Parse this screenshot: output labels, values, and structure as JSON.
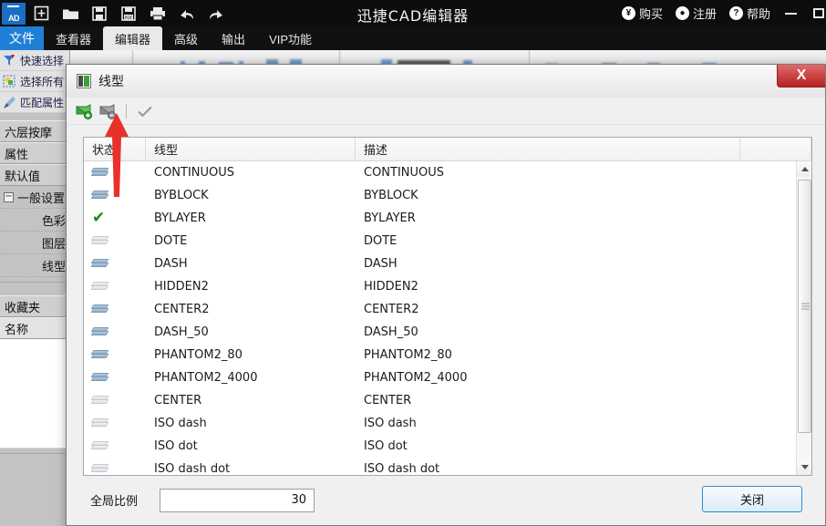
{
  "app": {
    "title": "迅捷CAD编辑器",
    "logo_text": "AD",
    "quick_tools": [
      {
        "name": "new-icon",
        "label": "新建"
      },
      {
        "name": "open-folder-icon",
        "label": "打开"
      },
      {
        "name": "save-icon",
        "label": "保存"
      },
      {
        "name": "save-pdf-icon",
        "label": "另存为PDF"
      },
      {
        "name": "print-icon",
        "label": "打印"
      },
      {
        "name": "undo-icon",
        "label": "撤销"
      },
      {
        "name": "redo-icon",
        "label": "恢复"
      }
    ],
    "right_items": [
      {
        "glyph": "¥",
        "label": "购买",
        "icon": "yen-icon"
      },
      {
        "glyph": "●",
        "label": "注册",
        "icon": "user-icon"
      },
      {
        "glyph": "?",
        "label": "帮助",
        "icon": "question-icon"
      }
    ],
    "window_buttons": [
      {
        "name": "minimize-button",
        "label": "—"
      },
      {
        "name": "maximize-button",
        "label": "□"
      }
    ]
  },
  "menubar": {
    "file_label": "文件",
    "tabs": [
      {
        "label": "查看器",
        "active": false
      },
      {
        "label": "编辑器",
        "active": true
      },
      {
        "label": "高级",
        "active": false
      },
      {
        "label": "输出",
        "active": false
      },
      {
        "label": "VIP功能",
        "active": false
      }
    ]
  },
  "left_panel": {
    "tools": [
      {
        "label": "快速选择",
        "icon": "funnel-icon"
      },
      {
        "label": "选择所有",
        "icon": "select-all-icon"
      },
      {
        "label": "匹配属性",
        "icon": "brush-icon"
      }
    ],
    "doc_tab": "六层按摩",
    "section_properties": "属性",
    "section_defaults": "默认值",
    "group_general": "一般设置",
    "group_items": [
      "色彩",
      "图层",
      "线型"
    ],
    "favorites_header": "收藏夹",
    "favorites_col": "名称"
  },
  "dialog": {
    "title": "线型",
    "close_glyph": "X",
    "toolbar": [
      {
        "name": "load-linetype-button",
        "label": "加载线型"
      },
      {
        "name": "delete-linetype-button",
        "label": "删除线型"
      },
      {
        "name": "set-current-button",
        "label": "置为当前"
      }
    ],
    "columns": [
      "状态",
      "线型",
      "描述",
      ""
    ],
    "rows": [
      {
        "status": "stack-dark",
        "linetype": "CONTINUOUS",
        "description": "CONTINUOUS"
      },
      {
        "status": "stack-dark",
        "linetype": "BYBLOCK",
        "description": "BYBLOCK"
      },
      {
        "status": "check",
        "linetype": "BYLAYER",
        "description": "BYLAYER"
      },
      {
        "status": "stack-pale",
        "linetype": "DOTE",
        "description": "DOTE"
      },
      {
        "status": "stack-dark",
        "linetype": "DASH",
        "description": "DASH"
      },
      {
        "status": "stack-pale",
        "linetype": "HIDDEN2",
        "description": "HIDDEN2"
      },
      {
        "status": "stack-dark",
        "linetype": "CENTER2",
        "description": "CENTER2"
      },
      {
        "status": "stack-dark",
        "linetype": "DASH_50",
        "description": "DASH_50"
      },
      {
        "status": "stack-dark",
        "linetype": "PHANTOM2_80",
        "description": "PHANTOM2_80"
      },
      {
        "status": "stack-dark",
        "linetype": "PHANTOM2_4000",
        "description": "PHANTOM2_4000"
      },
      {
        "status": "stack-pale",
        "linetype": "CENTER",
        "description": "CENTER"
      },
      {
        "status": "stack-pale",
        "linetype": "ISO dash",
        "description": "ISO dash"
      },
      {
        "status": "stack-pale",
        "linetype": "ISO dot",
        "description": "ISO dot"
      },
      {
        "status": "stack-pale",
        "linetype": "ISO dash dot",
        "description": "ISO dash dot"
      }
    ],
    "scale_label": "全局比例",
    "scale_value": "30",
    "close_button": "关闭"
  },
  "colors": {
    "accent_blue": "#1f7fd6",
    "titlebar": "#0d0d0f",
    "dialog_bg": "#f0f0f0",
    "close_red": "#b81f1f",
    "check_green": "#138a13",
    "annotation_red": "#e8312a",
    "button_border": "#2e8bd0"
  }
}
